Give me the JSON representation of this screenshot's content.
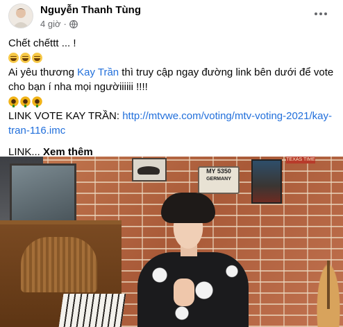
{
  "post": {
    "author": "Nguyễn Thanh Tùng",
    "time": "4 giờ",
    "time_separator": "·",
    "privacy_icon": "globe-icon",
    "more_icon": "more-options-icon",
    "lines": {
      "l1": "Chết chếttt ... !",
      "l2_prefix": "Ai yêu thương ",
      "l2_tag": "Kay Trần",
      "l2_suffix": " thì truy cập ngay đường link bên dưới để vote",
      "l3": "cho bạn í nha mọi ngườiiiiii !!!!",
      "l4_prefix": "LINK VOTE KAY TRẦN: ",
      "l4_link": "http://mtvwe.com/voting/mtv-voting-2021/kay-",
      "l5_link": "tran-116.imc",
      "l6_prefix": "LINK... ",
      "see_more": "Xem thêm"
    },
    "emoji": {
      "row1": [
        "laughing-face-emoji",
        "laughing-face-emoji",
        "laughing-face-emoji"
      ],
      "row2": [
        "sunflower-emoji",
        "sunflower-emoji",
        "sunflower-emoji"
      ]
    }
  },
  "media": {
    "plate_country": "GERMANY",
    "plate_text": "MY 5350",
    "sign_text": "TEXAS TIME"
  },
  "colors": {
    "link": "#216fdb",
    "secondary_text": "#65676b"
  }
}
